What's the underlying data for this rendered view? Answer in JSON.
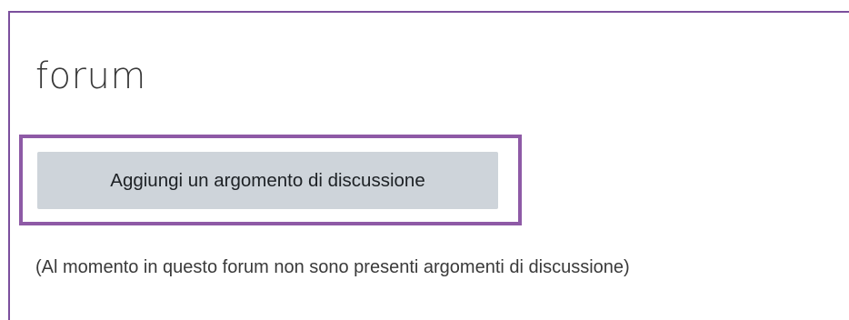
{
  "page": {
    "title": "forum"
  },
  "actions": {
    "add_topic_label": "Aggiungi un argomento di discussione"
  },
  "notice": {
    "text": "(Al momento in questo forum non sono presenti argomenti di discussione)"
  },
  "colors": {
    "highlight_border": "#8e5aa6",
    "panel_border": "#7b4f9d",
    "button_background": "#ced4da"
  }
}
